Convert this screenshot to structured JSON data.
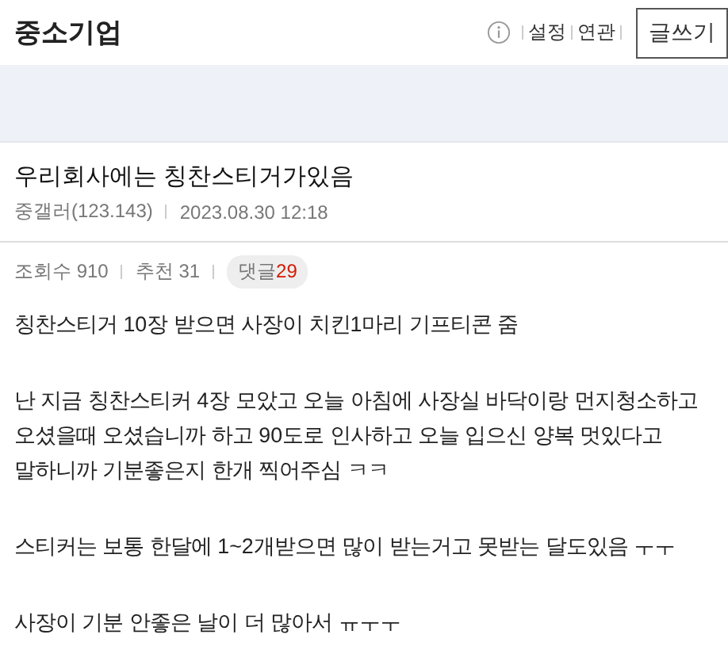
{
  "header": {
    "title": "중소기업",
    "links": [
      "설정",
      "연관"
    ],
    "write_button": "글쓰기"
  },
  "post": {
    "title": "우리회사에는 칭찬스티거가있음",
    "author": "중갤러(123.143)",
    "date": "2023.08.30 12:18",
    "stats": [
      {
        "label": "조회수",
        "value": "910",
        "kind": "plain"
      },
      {
        "label": "추천",
        "value": "31",
        "kind": "plain"
      },
      {
        "label": "댓글",
        "value": "29",
        "kind": "badge"
      }
    ],
    "paragraphs": [
      "칭찬스티거 10장 받으면 사장이 치킨1마리 기프티콘 줌",
      "난 지금 칭찬스티커 4장 모았고 오늘 아침에 사장실 바닥이랑 먼지청소하고 오셨을때 오셨습니까 하고 90도로 인사하고 오늘 입으신 양복 멋있다고 말하니까 기분좋은지 한개 찍어주심 ㅋㅋ",
      "스티커는 보통 한달에 1~2개받으면 많이 받는거고 못받는 달도있음 ㅜㅜ",
      "사장이 기분 안좋은 날이 더 많아서 ㅠㅜㅜ"
    ]
  }
}
